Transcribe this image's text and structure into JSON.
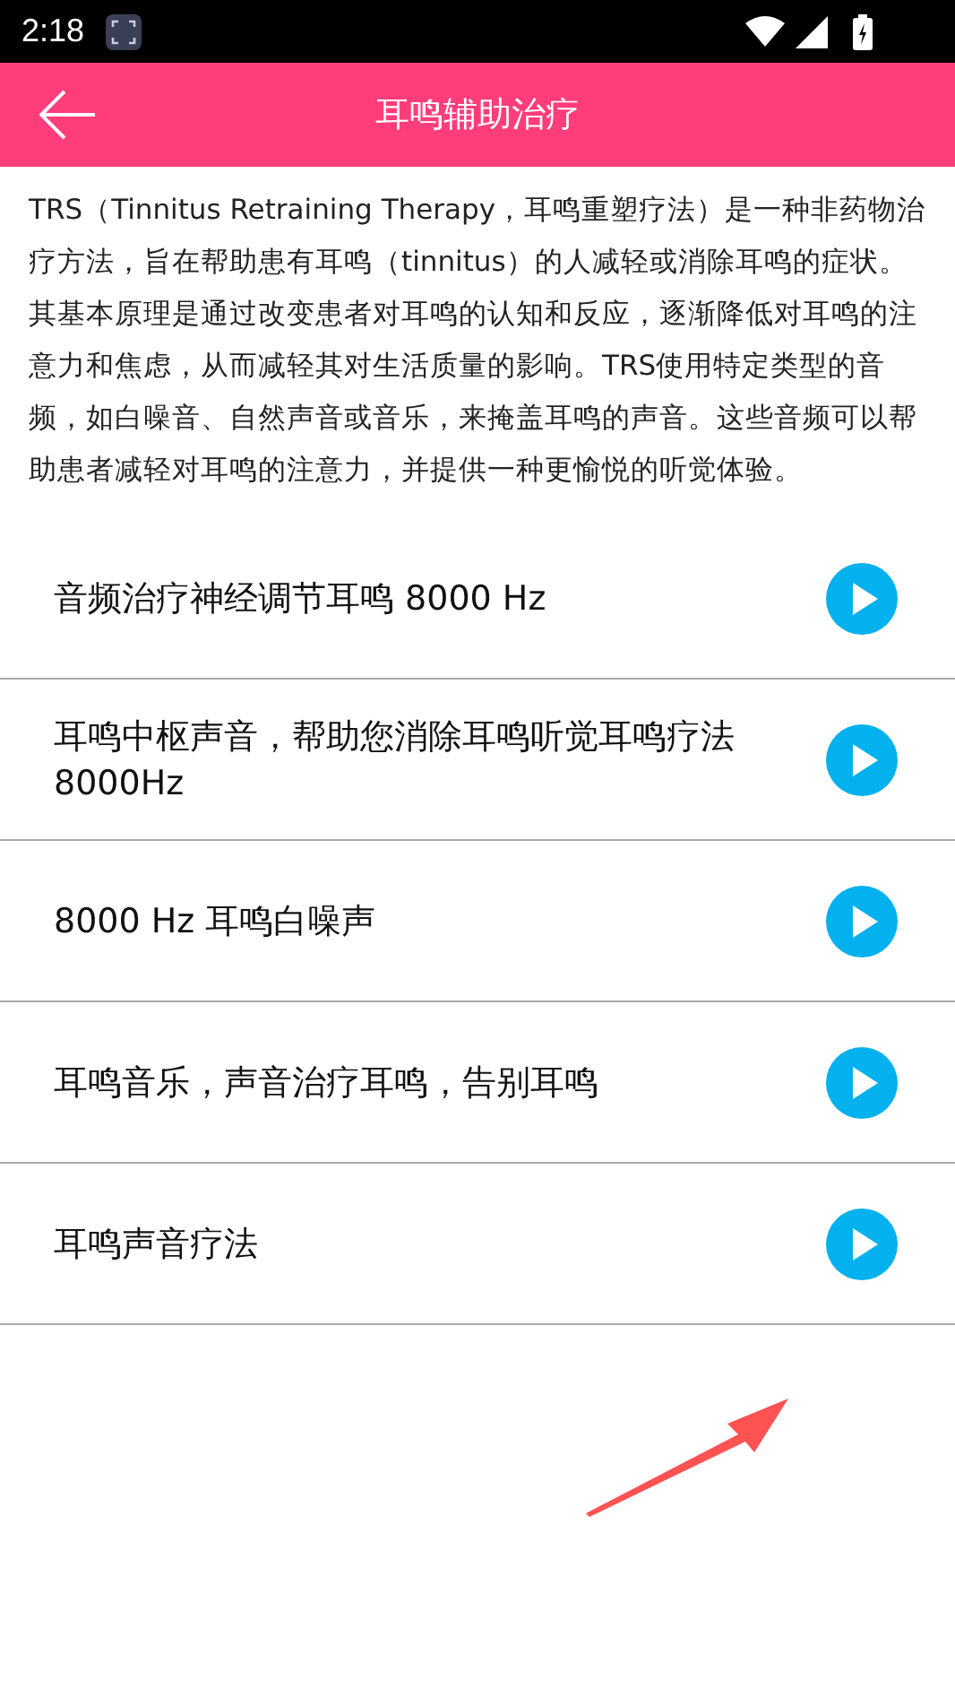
{
  "status_bar": {
    "time": "2:18"
  },
  "app_bar": {
    "title": "耳鸣辅助治疗"
  },
  "description": "TRS（Tinnitus Retraining Therapy，耳鸣重塑疗法）是一种非药物治疗方法，旨在帮助患有耳鸣（tinnitus）的人减轻或消除耳鸣的症状。其基本原理是通过改变患者对耳鸣的认知和反应，逐渐降低对耳鸣的注意力和焦虑，从而减轻其对生活质量的影响。TRS使用特定类型的音频，如白噪音、自然声音或音乐，来掩盖耳鸣的声音。这些音频可以帮助患者减轻对耳鸣的注意力，并提供一种更愉悦的听觉体验。",
  "tracks": [
    {
      "title": "音频治疗神经调节耳鸣 8000 Hz"
    },
    {
      "title": "耳鸣中枢声音，帮助您消除耳鸣听觉耳鸣疗法8000Hz"
    },
    {
      "title": "8000 Hz 耳鸣白噪声"
    },
    {
      "title": "耳鸣音乐，声音治疗耳鸣，告别耳鸣"
    },
    {
      "title": "耳鸣声音疗法"
    }
  ]
}
